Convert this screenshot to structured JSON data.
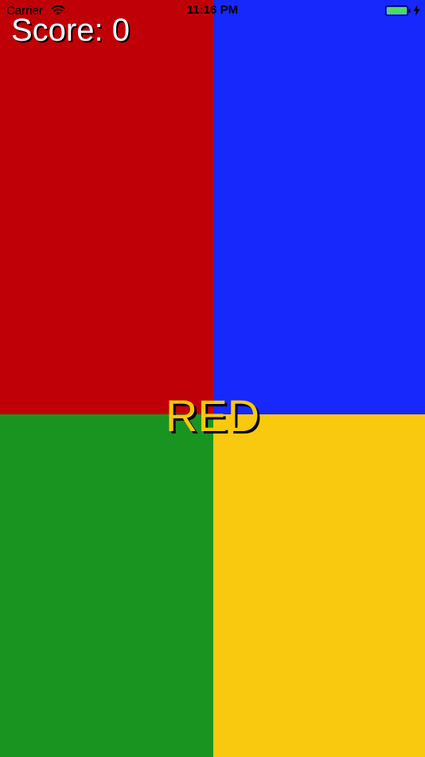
{
  "status_bar": {
    "carrier": "Carrier",
    "time": "11:16 PM",
    "battery_color": "#4cd964",
    "wifi_icon": "wifi-icon",
    "battery_icon": "battery-icon",
    "charging_icon": "bolt-icon"
  },
  "game": {
    "score_label": "Score: 0",
    "prompt_word": "RED",
    "prompt_color": "#f8c80c",
    "quadrants": [
      {
        "name": "red",
        "color": "#c00007"
      },
      {
        "name": "blue",
        "color": "#1628fc"
      },
      {
        "name": "green",
        "color": "#1a9420"
      },
      {
        "name": "yellow",
        "color": "#f9c90f"
      }
    ]
  }
}
